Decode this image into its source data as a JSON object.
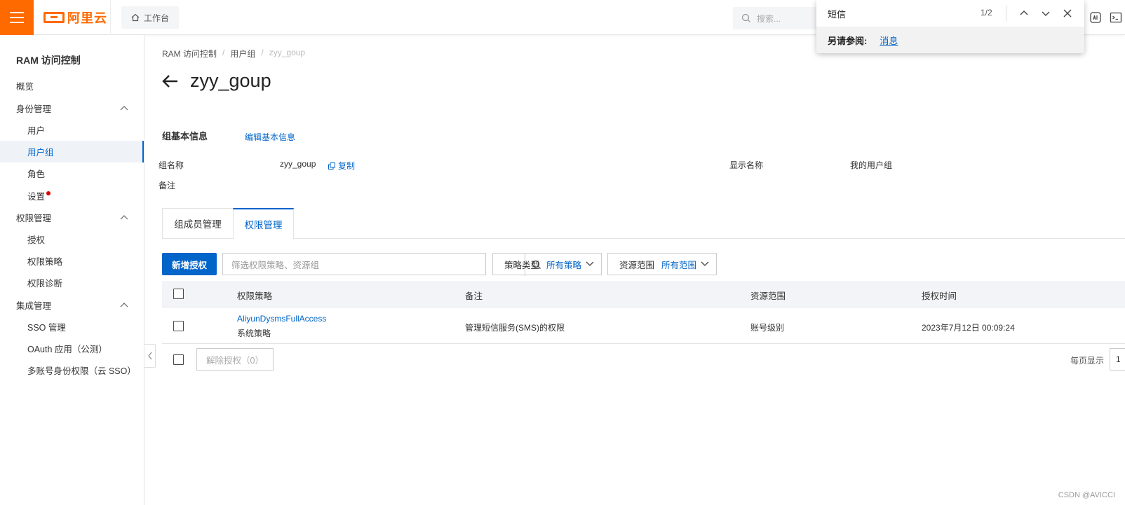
{
  "topbar": {
    "brand": "阿里云",
    "workbench_label": "工作台",
    "search_placeholder": "搜索..."
  },
  "find": {
    "query": "短信",
    "count": "1/2",
    "see_also_label": "另请参阅:",
    "see_also_link": "消息"
  },
  "sidebar": {
    "title": "RAM 访问控制",
    "items": [
      {
        "label": "概览"
      },
      {
        "label": "身份管理"
      },
      {
        "label": "用户"
      },
      {
        "label": "用户组"
      },
      {
        "label": "角色"
      },
      {
        "label": "设置"
      },
      {
        "label": "权限管理"
      },
      {
        "label": "授权"
      },
      {
        "label": "权限策略"
      },
      {
        "label": "权限诊断"
      },
      {
        "label": "集成管理"
      },
      {
        "label": "SSO 管理"
      },
      {
        "label": "OAuth 应用（公测）"
      },
      {
        "label": "多账号身份权限（云 SSO）"
      }
    ]
  },
  "breadcrumb": [
    "RAM 访问控制",
    "用户组",
    "zyy_goup"
  ],
  "page_title": "zyy_goup",
  "basic_info": {
    "title": "组基本信息",
    "edit_link": "编辑基本信息",
    "group_name_label": "组名称",
    "group_name_value": "zyy_goup",
    "copy_label": "复制",
    "display_name_label": "显示名称",
    "display_name_value": "我的用户组",
    "remark_label": "备注"
  },
  "tabs": [
    {
      "label": "组成员管理"
    },
    {
      "label": "权限管理"
    }
  ],
  "toolbar": {
    "add_button": "新增授权",
    "filter_placeholder": "筛选权限策略、资源组",
    "policy_type_label": "策略类型",
    "policy_type_value": "所有策略",
    "scope_label": "资源范围",
    "scope_value": "所有范围"
  },
  "table": {
    "headers": [
      "权限策略",
      "备注",
      "资源范围",
      "授权时间"
    ],
    "rows": [
      {
        "policy": "AliyunDysmsFullAccess",
        "policy_type": "系统策略",
        "remark": "管理短信服务(SMS)的权限",
        "scope": "账号级别",
        "time": "2023年7月12日 00:09:24"
      }
    ]
  },
  "footer": {
    "revoke_button": "解除授权（0）",
    "per_page_label": "每页显示",
    "per_page_value": "1"
  },
  "watermark": "CSDN @AVICCI",
  "colors": {
    "brand_orange": "#ff6a00",
    "link_blue": "#0064c8"
  }
}
